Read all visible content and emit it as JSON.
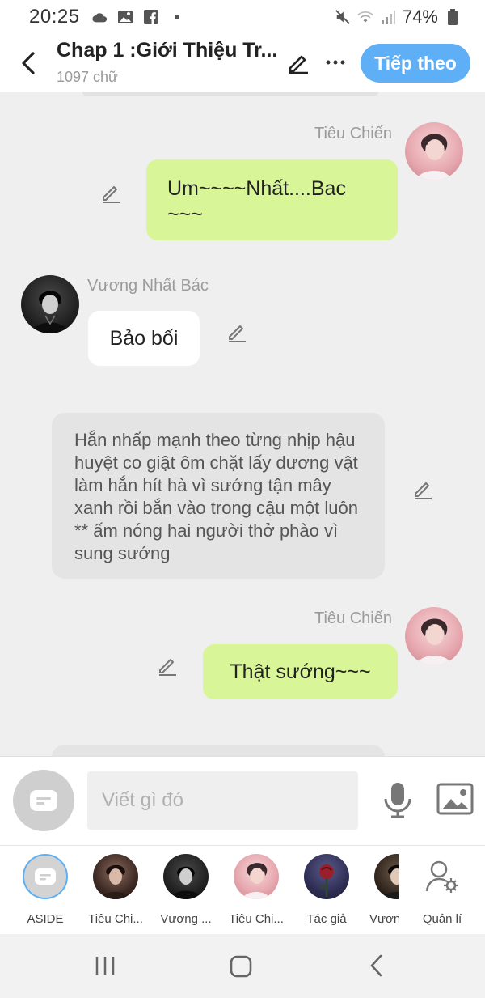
{
  "status": {
    "time": "20:25",
    "battery": "74%"
  },
  "header": {
    "title": "Chap 1 :Giới Thiệu Tr...",
    "word_count": "1097 chữ",
    "next_label": "Tiếp theo"
  },
  "messages": [
    {
      "speaker": "Tiêu Chiến",
      "text": "Um~~~~Nhất....Bac ~~~",
      "side": "right"
    },
    {
      "speaker": "Vương Nhất Bác",
      "text": "Bảo bối",
      "side": "left"
    },
    {
      "speaker": "",
      "text": "Hắn nhấp mạnh theo từng nhịp hậu huyệt co giật ôm chặt lấy dương vật làm hắn hít hà vì sướng tận mây xanh rồi bắn vào trong cậu một luôn ** ấm nóng hai người thở phào vì sung sướng",
      "side": "narration"
    },
    {
      "speaker": "Tiêu Chiến",
      "text": "Thật sướng~~~",
      "side": "right"
    }
  ],
  "input": {
    "placeholder": "Viết gì đó"
  },
  "characters": [
    {
      "label": "ASIDE"
    },
    {
      "label": "Tiêu Chi..."
    },
    {
      "label": "Vương ..."
    },
    {
      "label": "Tiêu Chi..."
    },
    {
      "label": "Tác giả"
    },
    {
      "label": "Vươn"
    },
    {
      "label": "Quản lí"
    }
  ],
  "colors": {
    "accent": "#5eaff5",
    "green_bubble": "#d8f597",
    "background": "#efefef"
  }
}
